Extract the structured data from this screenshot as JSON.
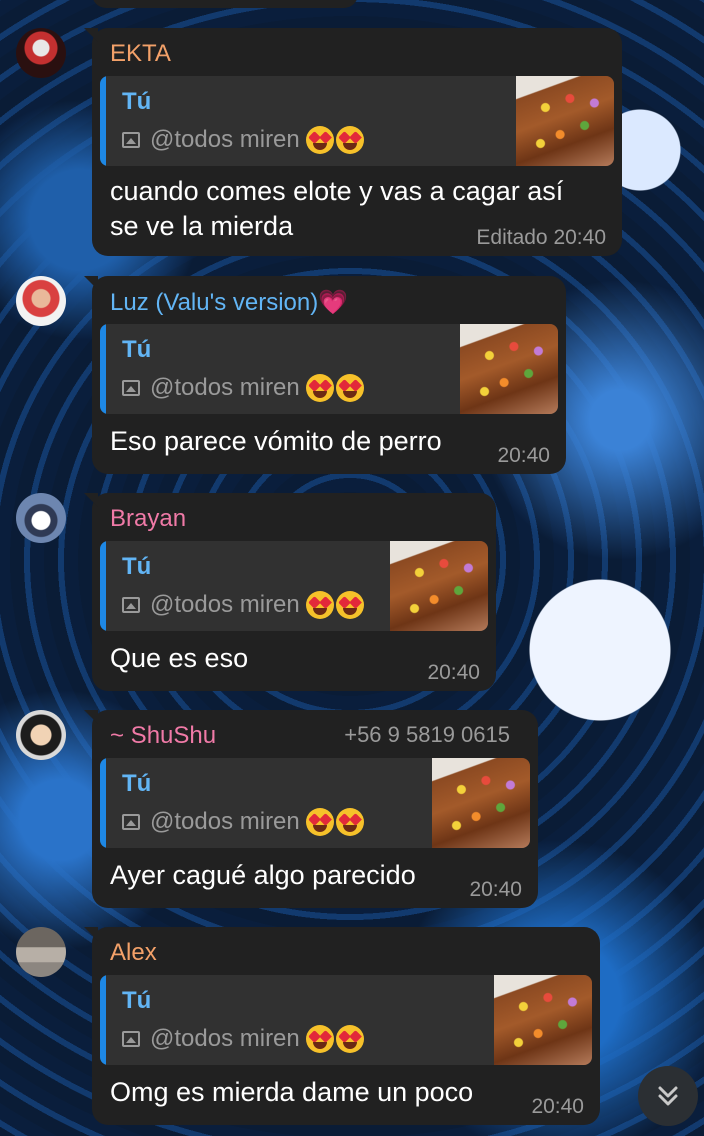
{
  "messages": [
    {
      "sender": "EKTA",
      "sender_color": "#f3a169",
      "avatar_color": "#7a1e1e",
      "reply_name": "Tú",
      "reply_text": "@todos miren",
      "text_lines": [
        "cuando comes elote y vas a cagar así",
        "se ve la mierda"
      ],
      "time": "Editado 20:40"
    },
    {
      "sender": "Luz (Valu's version)💗",
      "sender_color": "#62b5f5",
      "avatar_color": "#b23b3b",
      "reply_name": "Tú",
      "reply_text": "@todos miren",
      "text_lines": [
        "Eso parece vómito de perro"
      ],
      "time": "20:40"
    },
    {
      "sender": "Brayan",
      "sender_color": "#f07aa7",
      "avatar_color": "#6d86b0",
      "reply_name": "Tú",
      "reply_text": "@todos miren",
      "text_lines": [
        "Que es eso"
      ],
      "time": "20:40"
    },
    {
      "sender": "~ ShuShu",
      "sender_color": "#f07aa7",
      "phone": "+56 9 5819 0615",
      "avatar_color": "#3a3a3a",
      "reply_name": "Tú",
      "reply_text": "@todos miren",
      "text_lines": [
        "Ayer cagué algo parecido"
      ],
      "time": "20:40"
    },
    {
      "sender": "Alex",
      "sender_color": "#f3a169",
      "avatar_color": "#8c8680",
      "reply_name": "Tú",
      "reply_text": "@todos miren",
      "text_lines": [
        "Omg es mierda dame un poco"
      ],
      "time": "20:40"
    }
  ],
  "icons": {
    "reply_media": "image-icon",
    "emoji": "heart-eyes-emoji",
    "scroll": "double-chevron-down-icon"
  }
}
